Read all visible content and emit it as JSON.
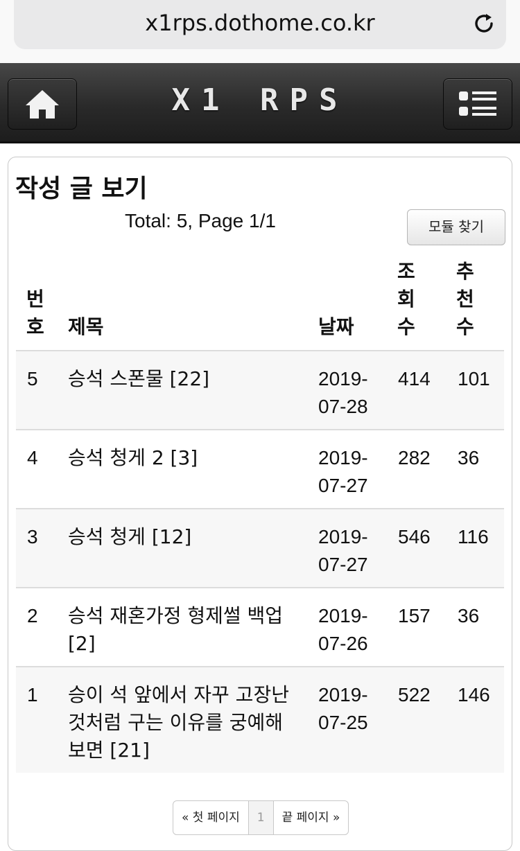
{
  "browser": {
    "url": "x1rps.dothome.co.kr"
  },
  "header": {
    "site_title": "X1 RPS"
  },
  "page": {
    "title": "작성 글 보기",
    "total_label": "Total: 5, Page 1/1",
    "module_button": "모듈 찾기"
  },
  "table": {
    "headers": {
      "no": "번호",
      "title": "제목",
      "date": "날짜",
      "views": "조회수",
      "recommend": "추천수"
    },
    "rows": [
      {
        "no": "5",
        "title": "승석 스폰물 [22]",
        "date": "2019-07-28",
        "views": "414",
        "recommend": "101"
      },
      {
        "no": "4",
        "title": "승석 청게 2 [3]",
        "date": "2019-07-27",
        "views": "282",
        "recommend": "36"
      },
      {
        "no": "3",
        "title": "승석 청게 [12]",
        "date": "2019-07-27",
        "views": "546",
        "recommend": "116"
      },
      {
        "no": "2",
        "title": "승석 재혼가정 형제썰 백업 [2]",
        "date": "2019-07-26",
        "views": "157",
        "recommend": "36"
      },
      {
        "no": "1",
        "title": "승이 석 앞에서 자꾸 고장난 것처럼 구는 이유를 궁예해보면 [21]",
        "date": "2019-07-25",
        "views": "522",
        "recommend": "146"
      }
    ]
  },
  "pagination": {
    "first": "« 첫 페이지",
    "current": "1",
    "last": "끝 페이지 »"
  },
  "icons": {
    "reload": "reload-icon",
    "home": "home-icon",
    "menu": "list-menu-icon"
  },
  "colors": {
    "header_bg": "#2a2a2a",
    "row_alt_bg": "#f7f7f7"
  }
}
